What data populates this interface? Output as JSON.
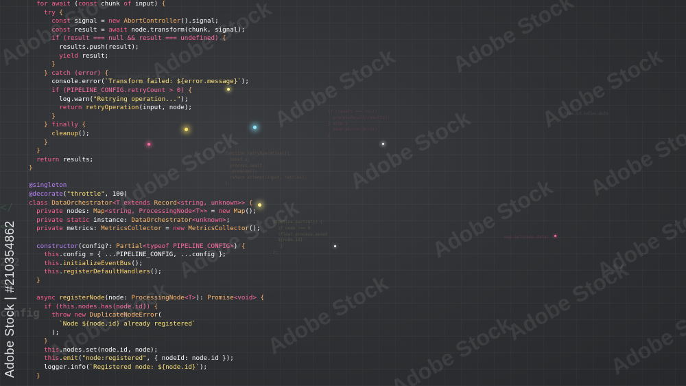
{
  "watermark": {
    "text": "Adobe Stock",
    "side_id": "Adobe Stock | #210354862"
  },
  "code_lines": [
    [
      [
        "k",
        "  for await "
      ],
      [
        "f",
        "("
      ],
      [
        "k",
        "const "
      ],
      [
        "f",
        "chunk "
      ],
      [
        "k",
        "of "
      ],
      [
        "f",
        "input) "
      ],
      [
        "p",
        "{"
      ]
    ],
    [
      [
        "k",
        "    try "
      ],
      [
        "p",
        "{"
      ]
    ],
    [
      [
        "k",
        "      const "
      ],
      [
        "f",
        "signal = "
      ],
      [
        "k",
        "new "
      ],
      [
        "t",
        "AbortController"
      ],
      [
        "f",
        "().signal;"
      ]
    ],
    [
      [
        "k",
        "      const "
      ],
      [
        "f",
        "result = "
      ],
      [
        "k",
        "await "
      ],
      [
        "f",
        "node.transform(chunk, signal);"
      ]
    ],
    [
      [
        "k",
        "      if "
      ],
      [
        "n",
        "(result === null && result === undefined) "
      ],
      [
        "p",
        "{"
      ]
    ],
    [
      [
        "f",
        "        results.push(result);"
      ]
    ],
    [
      [
        "k",
        "        yield "
      ],
      [
        "f",
        "result;"
      ]
    ],
    [
      [
        "p",
        "      }"
      ]
    ],
    [
      [
        "p",
        "    } "
      ],
      [
        "k",
        "catch "
      ],
      [
        "n",
        "(error) "
      ],
      [
        "p",
        "{"
      ]
    ],
    [
      [
        "f",
        "      console.error("
      ],
      [
        "s",
        "`Transform failed: ${error.message}`"
      ],
      [
        "f",
        ");"
      ]
    ],
    [
      [
        "k",
        "      if "
      ],
      [
        "n",
        "(PIPELINE_CONFIG.retryCount > 0) "
      ],
      [
        "p",
        "{"
      ]
    ],
    [
      [
        "f",
        "        log.warn("
      ],
      [
        "s",
        "\"Retrying operation...\""
      ],
      [
        "f",
        ");"
      ]
    ],
    [
      [
        "k",
        "        return "
      ],
      [
        "fn",
        "retryOperation"
      ],
      [
        "f",
        "(input, node);"
      ]
    ],
    [
      [
        "p",
        "      }"
      ]
    ],
    [
      [
        "p",
        "    } "
      ],
      [
        "k",
        "finally "
      ],
      [
        "p",
        "{"
      ]
    ],
    [
      [
        "fn",
        "      cleanup"
      ],
      [
        "f",
        "();"
      ]
    ],
    [
      [
        "p",
        "    }"
      ]
    ],
    [
      [
        "p",
        "  }"
      ]
    ],
    [
      [
        "k",
        "  return "
      ],
      [
        "f",
        "results;"
      ]
    ],
    [
      [
        "p",
        "}"
      ]
    ],
    [
      [
        "f",
        ""
      ]
    ],
    [
      [
        "d",
        "@singleton"
      ]
    ],
    [
      [
        "d",
        "@decorate"
      ],
      [
        "f",
        "("
      ],
      [
        "s",
        "\"throttle\""
      ],
      [
        "f",
        ", 100)"
      ]
    ],
    [
      [
        "k",
        "class "
      ],
      [
        "t",
        "DataOrchestrator"
      ],
      [
        "n",
        "<T "
      ],
      [
        "k",
        "extends "
      ],
      [
        "t",
        "Record"
      ],
      [
        "n",
        "<string, unknown>> "
      ],
      [
        "p",
        "{"
      ]
    ],
    [
      [
        "k",
        "  private "
      ],
      [
        "f",
        "nodes: "
      ],
      [
        "t",
        "Map"
      ],
      [
        "n",
        "<string, ProcessingNode<T>> "
      ],
      [
        "f",
        "= "
      ],
      [
        "k",
        "new "
      ],
      [
        "t",
        "Map"
      ],
      [
        "f",
        "();"
      ]
    ],
    [
      [
        "k",
        "  private static "
      ],
      [
        "f",
        "instance: "
      ],
      [
        "t",
        "DataOrchestrator"
      ],
      [
        "n",
        "<unknown>"
      ],
      [
        "f",
        ";"
      ]
    ],
    [
      [
        "k",
        "  private "
      ],
      [
        "f",
        "metrics: "
      ],
      [
        "t",
        "MetricsCollector "
      ],
      [
        "f",
        "= "
      ],
      [
        "k",
        "new "
      ],
      [
        "t",
        "MetricsCollector"
      ],
      [
        "f",
        "();"
      ]
    ],
    [
      [
        "f",
        ""
      ]
    ],
    [
      [
        "d",
        "  constructor"
      ],
      [
        "f",
        "(config?: "
      ],
      [
        "t",
        "Partial"
      ],
      [
        "n",
        "<typeof PIPELINE_CONFIG>"
      ],
      [
        "f",
        ") "
      ],
      [
        "p",
        "{"
      ]
    ],
    [
      [
        "k",
        "    this"
      ],
      [
        "f",
        ".config = { ...PIPELINE_CONFIG, ...config };"
      ]
    ],
    [
      [
        "k",
        "    this"
      ],
      [
        "f",
        "."
      ],
      [
        "fn",
        "initializeEventBus"
      ],
      [
        "f",
        "();"
      ]
    ],
    [
      [
        "k",
        "    this"
      ],
      [
        "f",
        "."
      ],
      [
        "fn",
        "registerDefaultHandlers"
      ],
      [
        "f",
        "();"
      ]
    ],
    [
      [
        "p",
        "  }"
      ]
    ],
    [
      [
        "f",
        ""
      ]
    ],
    [
      [
        "k",
        "  async "
      ],
      [
        "fn",
        "registerNode"
      ],
      [
        "f",
        "(node: "
      ],
      [
        "t",
        "ProcessingNode"
      ],
      [
        "n",
        "<T>"
      ],
      [
        "f",
        "): "
      ],
      [
        "t",
        "Promise"
      ],
      [
        "n",
        "<void> "
      ],
      [
        "p",
        "{"
      ]
    ],
    [
      [
        "k",
        "    if "
      ],
      [
        "n",
        "(this.nodes.has(node.id)) "
      ],
      [
        "p",
        "{"
      ]
    ],
    [
      [
        "k",
        "      throw new "
      ],
      [
        "t",
        "DuplicateNodeError"
      ],
      [
        "f",
        "("
      ]
    ],
    [
      [
        "s",
        "        `Node ${node.id} already registered`"
      ]
    ],
    [
      [
        "f",
        "      );"
      ]
    ],
    [
      [
        "p",
        "    }"
      ]
    ],
    [
      [
        "k",
        "    this"
      ],
      [
        "f",
        ".nodes.set(node.id, node);"
      ]
    ],
    [
      [
        "k",
        "    this"
      ],
      [
        "f",
        "."
      ],
      [
        "fn",
        "emit"
      ],
      [
        "f",
        "("
      ],
      [
        "s",
        "\"node:registered\""
      ],
      [
        "f",
        ", { nodeId: node.id });"
      ]
    ],
    [
      [
        "f",
        "    logger.info("
      ],
      [
        "s",
        "`Registered node: ${node.id}`"
      ],
      [
        "f",
        ");"
      ]
    ],
    [
      [
        "p",
        "  }"
      ]
    ]
  ],
  "ghost_blocks": [
    {
      "lines": [
        "const pipeline = new Pipeline(",
        "  debug: \"verbose\" },"
      ],
      "color": "rgba(255,255,255,0.10)"
    },
    {
      "lines": [
        "if (result === null)",
        "  processResult(results);",
        "} else {",
        "  handleError(error);",
        "}"
      ],
      "color": "rgba(255,95,143,0.18)"
    },
    {
      "lines": [
        "function retryOperation(){",
        "  const x;",
        "  process.await",
        "  .promise();",
        "  return attempt(input, retries);",
        "};"
      ],
      "color": "rgba(255,179,107,0.16)"
    },
    {
      "lines": [
        "pipeline.partial() {",
        "  if node !== 0",
        "  (flow).process.asset",
        "  ${node.id}",
        "  `}`",
        "};"
      ],
      "color": "rgba(253,226,122,0.16)"
    },
    {
      "lines": [
        "map.set(node.data)"
      ],
      "color": "rgba(255,95,143,0.20)"
    },
    {
      "lines": [
        "node.id.value.data"
      ],
      "color": "rgba(255,255,255,0.10)"
    }
  ],
  "ghost_left": [
    "</",
    "<<",
    "212",
    "Se",
    "config"
  ]
}
